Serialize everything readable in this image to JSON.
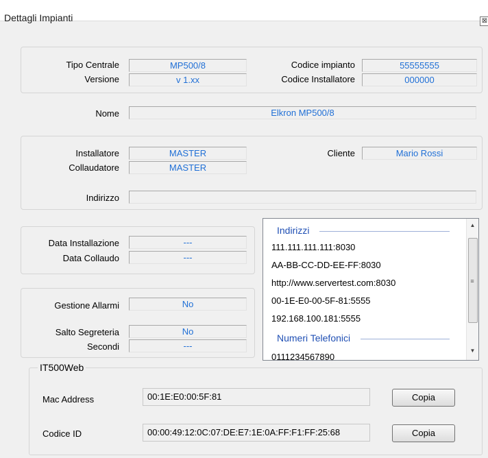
{
  "window": {
    "title": "Dettagli Impianti",
    "close_glyph": "⊠"
  },
  "central": {
    "tipo_label": "Tipo Centrale",
    "tipo_value": "MP500/8",
    "versione_label": "Versione",
    "versione_value": "v 1.xx",
    "codice_impianto_label": "Codice impianto",
    "codice_impianto_value": "55555555",
    "codice_installatore_label": "Codice Installatore",
    "codice_installatore_value": "000000"
  },
  "nome": {
    "label": "Nome",
    "value": "Elkron MP500/8"
  },
  "people": {
    "installatore_label": "Installatore",
    "installatore_value": "MASTER",
    "collaudatore_label": "Collaudatore",
    "collaudatore_value": "MASTER",
    "cliente_label": "Cliente",
    "cliente_value": "Mario Rossi",
    "indirizzo_label": "Indirizzo",
    "indirizzo_value": ""
  },
  "dates": {
    "installazione_label": "Data Installazione",
    "installazione_value": "---",
    "collaudo_label": "Data Collaudo",
    "collaudo_value": "---"
  },
  "alarms": {
    "gestione_label": "Gestione Allarmi",
    "gestione_value": "No",
    "salto_label": "Salto Segreteria",
    "salto_value": "No",
    "secondi_label": "Secondi",
    "secondi_value": "---"
  },
  "list": {
    "indirizzi_title": "Indirizzi",
    "indirizzi": [
      "111.111.111.111:8030",
      "AA-BB-CC-DD-EE-FF:8030",
      "http://www.servertest.com:8030",
      "00-1E-E0-00-5F-81:5555",
      "192.168.100.181:5555"
    ],
    "numeri_title": "Numeri Telefonici",
    "numeri": [
      "0111234567890"
    ],
    "scroll_up": "▲",
    "scroll_down": "▼",
    "grip": "≡"
  },
  "it500web": {
    "title": "IT500Web",
    "mac_label": "Mac Address",
    "mac_value": "00:1E:E0:00:5F:81",
    "id_label": "Codice ID",
    "id_value": "00:00:49:12:0C:07:DE:E7:1E:0A:FF:F1:FF:25:68",
    "copy_label": "Copia"
  }
}
